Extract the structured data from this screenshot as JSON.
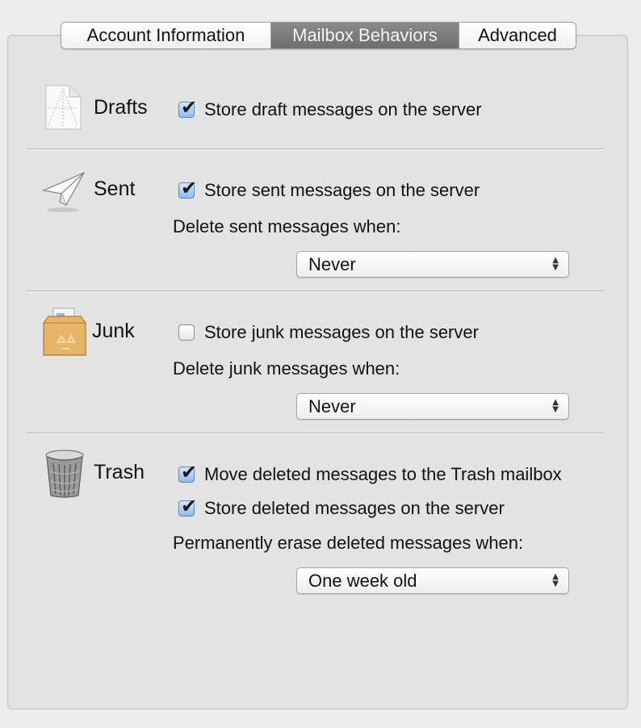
{
  "tabs": [
    {
      "label": "Account Information",
      "selected": false
    },
    {
      "label": "Mailbox Behaviors",
      "selected": true
    },
    {
      "label": "Advanced",
      "selected": false
    }
  ],
  "sections": {
    "drafts": {
      "title": "Drafts",
      "icon": "draft-document-icon",
      "store_label": "Store draft messages on the server",
      "store_checked": true
    },
    "sent": {
      "title": "Sent",
      "icon": "paper-plane-icon",
      "store_label": "Store sent messages on the server",
      "store_checked": true,
      "delete_label": "Delete sent messages when:",
      "delete_value": "Never"
    },
    "junk": {
      "title": "Junk",
      "icon": "junk-box-icon",
      "store_label": "Store junk messages on the server",
      "store_checked": false,
      "delete_label": "Delete junk messages when:",
      "delete_value": "Never"
    },
    "trash": {
      "title": "Trash",
      "icon": "trash-can-icon",
      "move_label": "Move deleted messages to the Trash mailbox",
      "move_checked": true,
      "store_label": "Store deleted messages on the server",
      "store_checked": true,
      "erase_label": "Permanently erase deleted messages when:",
      "erase_value": "One week old"
    }
  },
  "colors": {
    "selected_tab": "#7c7c7c",
    "checkbox_checked": "#8fbbe9",
    "panel_background": "#e3e3e3"
  }
}
